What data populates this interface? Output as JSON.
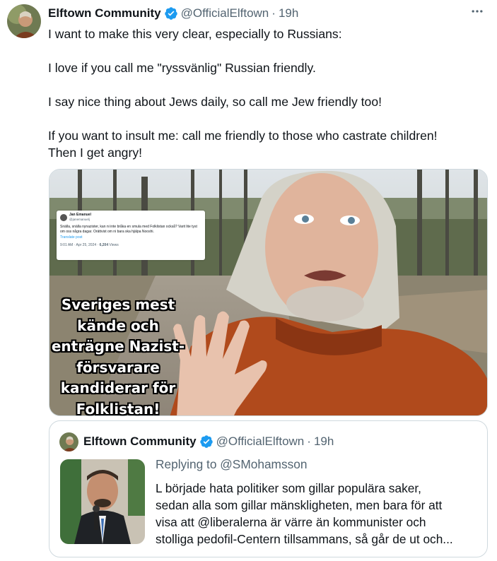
{
  "tweet": {
    "author_name": "Elftown Community",
    "handle": "@OfficialElftown",
    "separator": "·",
    "time": "19h",
    "more_icon": "more-icon",
    "lines": [
      "I want to make this very clear, especially to Russians:",
      "I love if you call me \"ryssvänlig\" Russian friendly.",
      "I say nice thing about Jews daily, so call me Jew friendly too!",
      "If you want to insult me: call me friendly to those who castrate children!",
      "Then I get angry!"
    ]
  },
  "media": {
    "overlay_lines": [
      "Sveriges mest",
      "kände och",
      "enträgne Nazist-",
      "försvarare",
      "kandiderar för",
      "Folklistan!"
    ],
    "embedded_post": {
      "name": "Jan Emanuel",
      "handle": "@janemanuelj",
      "body": "Snälla, snälla nynazister, kan ni inte bråka en smula med Folklistan också? Varit lite tyst om oss några dagar. Orättvist om ni bara ska hjälpa Nooshi.",
      "translate": "Translate post",
      "meta_time": "9:01 AM · Apr 25, 2024 · ",
      "meta_views": "6,204",
      "meta_views_label": " Views"
    }
  },
  "quoted": {
    "author_name": "Elftown Community",
    "handle": "@OfficialElftown",
    "separator": "·",
    "time": "19h",
    "replying_to": "Replying to @SMohamsson",
    "text_lines": [
      "L började hata politiker som gillar populära saker,",
      "sedan alla som gillar mänskligheten, men bara för att",
      "visa att @liberalerna är värre än kommunister och",
      "stolliga pedofil-Centern tillsammans, så går de ut och..."
    ]
  },
  "colors": {
    "text": "#0f1419",
    "secondary": "#536471",
    "verified": "#1d9bf0",
    "border": "#cfd9de",
    "sweater": "#b04a1c"
  }
}
